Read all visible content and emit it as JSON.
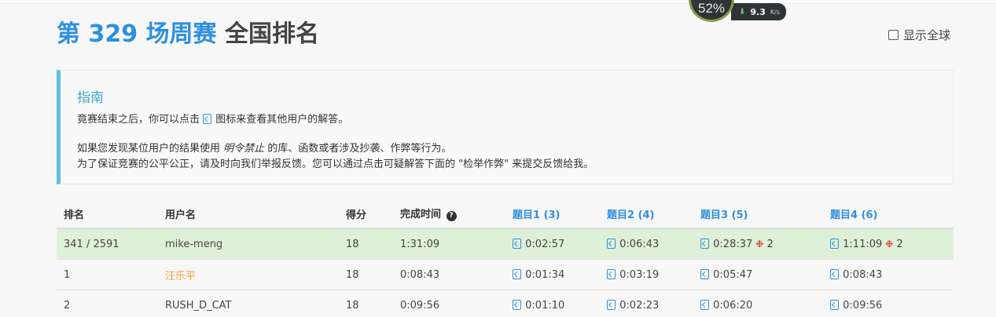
{
  "header": {
    "title_accent": "第 329 场周赛",
    "title_rest": " 全国排名",
    "global_toggle_label": "显示全球"
  },
  "net_widget": {
    "percent": "52%",
    "speed_value": "9.3",
    "speed_unit": "K/s"
  },
  "guide": {
    "title": "指南",
    "line1_before": "竟赛结束之后，你可以点击",
    "line1_after": "图标来查看其他用户的解答。",
    "line2_before": "如果您发现某位用户的结果使用",
    "line2_em": "明令禁止",
    "line2_after": "的库、函数或者涉及抄袭、作弊等行为。",
    "line3": "为了保证竞赛的公平公正，请及时向我们举报反馈。您可以通过点击可疑解答下面的 \"检举作弊\" 来提交反馈给我。"
  },
  "table": {
    "headers": {
      "rank": "排名",
      "user": "用户名",
      "score": "得分",
      "time": "完成时间",
      "q1": "题目1 (3)",
      "q2": "题目2 (4)",
      "q3": "题目3 (5)",
      "q4": "题目4 (6)"
    },
    "rows": [
      {
        "rank": "341 / 2591",
        "user": "mike-meng",
        "score": "18",
        "time": "1:31:09",
        "q1": "0:02:57",
        "q2": "0:06:43",
        "q3": "0:28:37",
        "q3_bugs": "2",
        "q4": "1:11:09",
        "q4_bugs": "2"
      },
      {
        "rank": "1",
        "user": "汪乐平",
        "score": "18",
        "time": "0:08:43",
        "q1": "0:01:34",
        "q2": "0:03:19",
        "q3": "0:05:47",
        "q4": "0:08:43"
      },
      {
        "rank": "2",
        "user": "RUSH_D_CAT",
        "score": "18",
        "time": "0:09:56",
        "q1": "0:01:10",
        "q2": "0:02:23",
        "q3": "0:06:20",
        "q4": "0:09:56"
      }
    ]
  }
}
